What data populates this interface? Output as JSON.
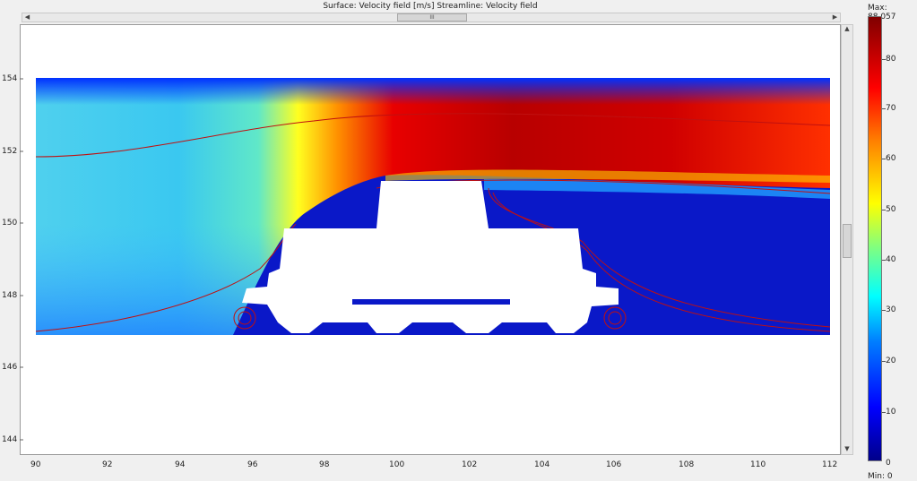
{
  "title": "Surface: Velocity field [m/s]   Streamline: Velocity field",
  "scrollbar_grip": "III",
  "y_ticks": [
    "154",
    "152",
    "150",
    "148",
    "146",
    "144"
  ],
  "x_ticks": [
    "90",
    "92",
    "94",
    "96",
    "98",
    "100",
    "102",
    "104",
    "106",
    "108",
    "110",
    "112"
  ],
  "colorbar": {
    "max_label": "Max: 88.057",
    "min_label": "Min: 0",
    "ticks": [
      "80",
      "70",
      "60",
      "50",
      "40",
      "30",
      "20",
      "10",
      "0"
    ]
  }
}
